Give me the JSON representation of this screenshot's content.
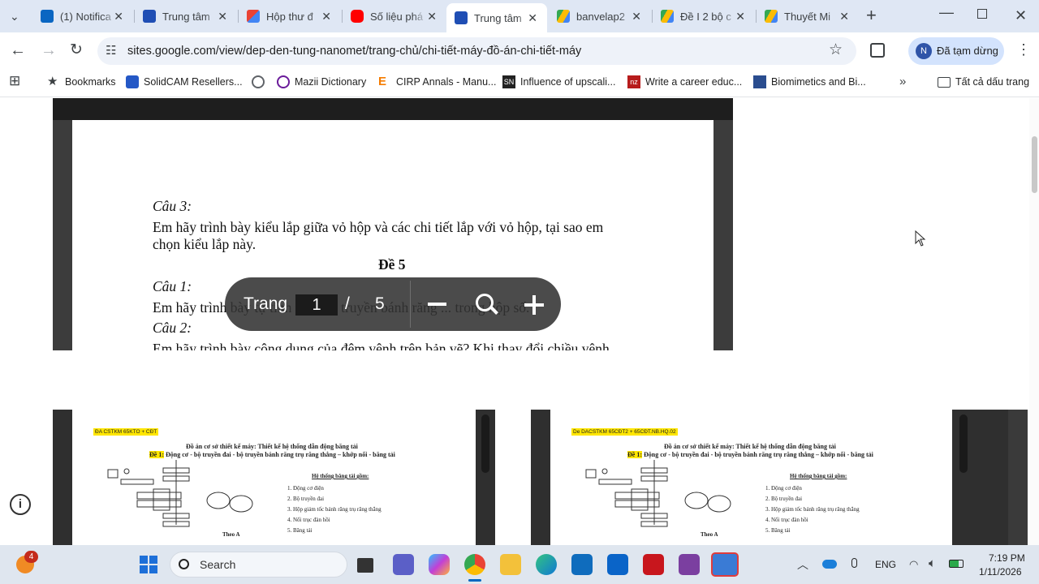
{
  "tabs": [
    {
      "title": "(1) Notifica",
      "favicon_color": "#0a66c2",
      "icon": "linkedin-icon"
    },
    {
      "title": "Trung tâm",
      "favicon_color": "#1f4eb4",
      "icon": "google-sites-icon"
    },
    {
      "title": "Hộp thư đ",
      "favicon_color": "#ea4335",
      "icon": "gmail-icon"
    },
    {
      "title": "Số liệu phá",
      "favicon_color": "#ff0000",
      "icon": "youtube-icon"
    },
    {
      "title": "Trung tâm",
      "favicon_color": "#1f4eb4",
      "icon": "google-sites-icon",
      "active": true
    },
    {
      "title": "banvelap2",
      "favicon_color": "#34a853",
      "icon": "google-drive-icon"
    },
    {
      "title": "Đề I 2 bộ c",
      "favicon_color": "#34a853",
      "icon": "google-drive-icon"
    },
    {
      "title": "Thuyết Mi",
      "favicon_color": "#34a853",
      "icon": "google-drive-icon"
    }
  ],
  "address_bar": {
    "url": "sites.google.com/view/dep-den-tung-nanomet/trang-chủ/chi-tiết-máy-đồ-án-chi-tiết-máy"
  },
  "profile": {
    "initial": "N",
    "label": "Đã tạm dừng"
  },
  "bookmarks": [
    {
      "label": "Bookmarks",
      "icon": "star-icon"
    },
    {
      "label": "SolidCAM Resellers...",
      "icon": "solidcam-icon"
    },
    {
      "label": "",
      "icon": "globe-icon"
    },
    {
      "label": "Mazii Dictionary",
      "icon": "mazii-icon"
    },
    {
      "label": "CIRP Annals - Manu...",
      "icon": "elsevier-icon"
    },
    {
      "label": "Influence of upscali...",
      "icon": "springer-icon"
    },
    {
      "label": "Write a career educ...",
      "icon": "nz-icon"
    },
    {
      "label": "Biomimetics and Bi...",
      "icon": "mdpi-icon"
    }
  ],
  "all_bookmarks_label": "Tất cả dấu trang",
  "document": {
    "q3_title": "Câu 3:",
    "q3_line1": "Em hãy trình bày kiểu lắp giữa vỏ hộp và các chi tiết lắp với vỏ hộp, tại sao em",
    "q3_line2": "chọn kiểu lắp này.",
    "section": "Đề 5",
    "q1_title": "Câu 1:",
    "q1_text": "Em hãy trình bày tự tính toán bộ truyền bánh răng ... trong hộp số.",
    "q2_title": "Câu 2:",
    "q2_text": "Em hãy trình bày công dụng của đệm vênh trên bản vẽ? Khi thay đổi chiều vênh"
  },
  "page_controls": {
    "label": "Trang",
    "current": "1",
    "separator": "/",
    "total": "5"
  },
  "thumb_left": {
    "tag": "ĐA CSTKM 65KTO + CĐT",
    "title": "Đồ án cơ sở thiết kế máy: Thiết kế hệ thống dẫn động băng tải",
    "subtitle_hl": "Đề 1:",
    "subtitle": "Động cơ - bộ truyền đai - bộ truyền bánh răng trụ răng thẳng – khớp nối - băng tải",
    "list_title": "Hệ thống băng tải gồm:",
    "items": [
      "1.  Động cơ điện",
      "2.  Bộ truyền đai",
      "3.  Hộp giảm tốc bánh răng trụ răng thẳng",
      "4.  Nối trục đàn hồi",
      "5.  Băng tải"
    ],
    "view_label": "Theo A"
  },
  "thumb_right": {
    "tag": "De DACSTKM 65CĐT2 + 65CĐT.NB.HQ.02",
    "title": "Đồ án cơ sở thiết kế máy: Thiết kế hệ thống dẫn động băng tải",
    "subtitle_hl": "Đề 1:",
    "subtitle": "Động cơ - bộ truyền đai - bộ truyền bánh răng trụ răng thẳng – khớp nối - băng tải",
    "list_title": "Hệ thống băng tải gồm:",
    "items": [
      "1.  Động cơ điện",
      "2.  Bộ truyền đai",
      "3.  Hộp giảm tốc bánh răng trụ răng thẳng",
      "4.  Nối trục đàn hồi",
      "5.  Băng tải"
    ],
    "view_label": "Theo A"
  },
  "taskbar": {
    "badge": "4",
    "search_label": "Search",
    "lang": "ENG",
    "time": "7:19 PM",
    "date": "1/11/2026"
  }
}
